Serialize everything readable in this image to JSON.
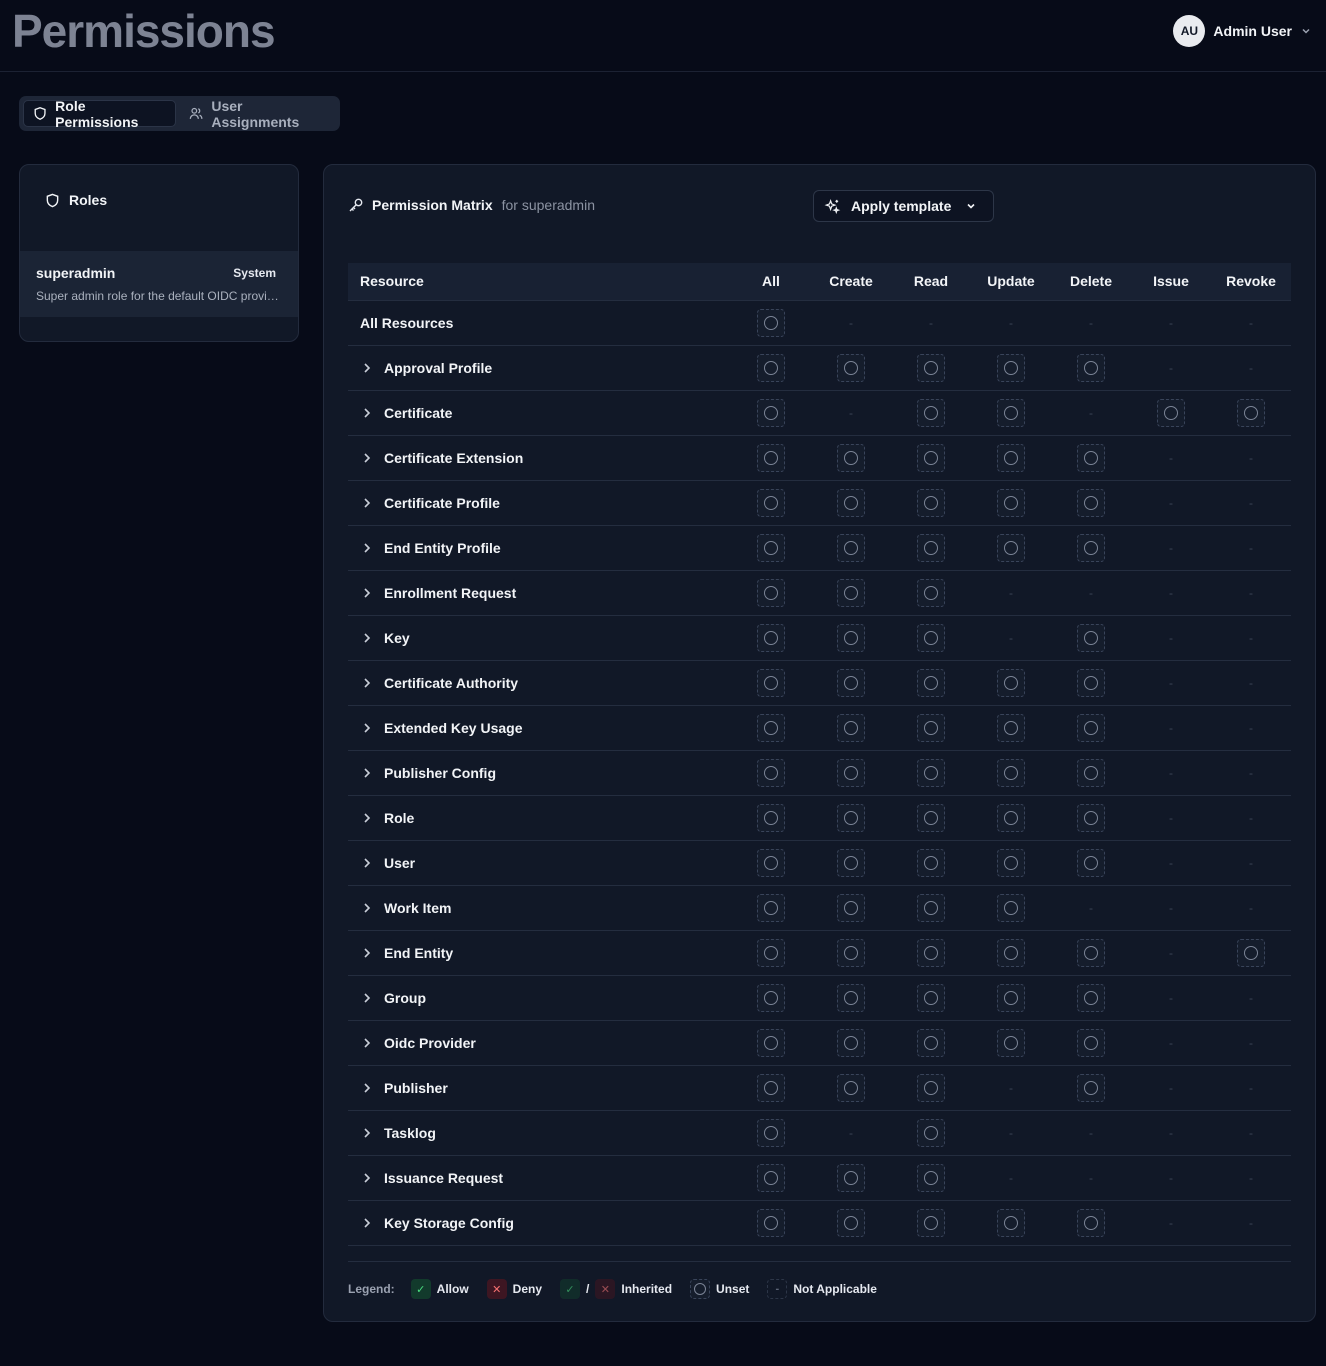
{
  "header": {
    "title": "Permissions",
    "user": {
      "initials": "AU",
      "name": "Admin User"
    }
  },
  "tabs": [
    {
      "label": "Role Permissions",
      "active": true
    },
    {
      "label": "User Assignments",
      "active": false
    }
  ],
  "roles": {
    "heading": "Roles",
    "items": [
      {
        "name": "superadmin",
        "badge": "System",
        "description": "Super admin role for the default OIDC provider"
      }
    ]
  },
  "matrix": {
    "title": "Permission Matrix",
    "subtitle": "for superadmin",
    "apply_template_label": "Apply template",
    "columns": [
      "Resource",
      "All",
      "Create",
      "Read",
      "Update",
      "Delete",
      "Issue",
      "Revoke"
    ],
    "na_symbol": "-",
    "rows": [
      {
        "name": "All Resources",
        "expandable": false,
        "cells": [
          "unset",
          "na",
          "na",
          "na",
          "na",
          "na",
          "na"
        ]
      },
      {
        "name": "Approval Profile",
        "expandable": true,
        "cells": [
          "unset",
          "unset",
          "unset",
          "unset",
          "unset",
          "na",
          "na"
        ]
      },
      {
        "name": "Certificate",
        "expandable": true,
        "cells": [
          "unset",
          "na",
          "unset",
          "unset",
          "na",
          "unset",
          "unset"
        ]
      },
      {
        "name": "Certificate Extension",
        "expandable": true,
        "cells": [
          "unset",
          "unset",
          "unset",
          "unset",
          "unset",
          "na",
          "na"
        ]
      },
      {
        "name": "Certificate Profile",
        "expandable": true,
        "cells": [
          "unset",
          "unset",
          "unset",
          "unset",
          "unset",
          "na",
          "na"
        ]
      },
      {
        "name": "End Entity Profile",
        "expandable": true,
        "cells": [
          "unset",
          "unset",
          "unset",
          "unset",
          "unset",
          "na",
          "na"
        ]
      },
      {
        "name": "Enrollment Request",
        "expandable": true,
        "cells": [
          "unset",
          "unset",
          "unset",
          "na",
          "na",
          "na",
          "na"
        ]
      },
      {
        "name": "Key",
        "expandable": true,
        "cells": [
          "unset",
          "unset",
          "unset",
          "na",
          "unset",
          "na",
          "na"
        ]
      },
      {
        "name": "Certificate Authority",
        "expandable": true,
        "cells": [
          "unset",
          "unset",
          "unset",
          "unset",
          "unset",
          "na",
          "na"
        ]
      },
      {
        "name": "Extended Key Usage",
        "expandable": true,
        "cells": [
          "unset",
          "unset",
          "unset",
          "unset",
          "unset",
          "na",
          "na"
        ]
      },
      {
        "name": "Publisher Config",
        "expandable": true,
        "cells": [
          "unset",
          "unset",
          "unset",
          "unset",
          "unset",
          "na",
          "na"
        ]
      },
      {
        "name": "Role",
        "expandable": true,
        "cells": [
          "unset",
          "unset",
          "unset",
          "unset",
          "unset",
          "na",
          "na"
        ]
      },
      {
        "name": "User",
        "expandable": true,
        "cells": [
          "unset",
          "unset",
          "unset",
          "unset",
          "unset",
          "na",
          "na"
        ]
      },
      {
        "name": "Work Item",
        "expandable": true,
        "cells": [
          "unset",
          "unset",
          "unset",
          "unset",
          "na",
          "na",
          "na"
        ]
      },
      {
        "name": "End Entity",
        "expandable": true,
        "cells": [
          "unset",
          "unset",
          "unset",
          "unset",
          "unset",
          "na",
          "unset"
        ]
      },
      {
        "name": "Group",
        "expandable": true,
        "cells": [
          "unset",
          "unset",
          "unset",
          "unset",
          "unset",
          "na",
          "na"
        ]
      },
      {
        "name": "Oidc Provider",
        "expandable": true,
        "cells": [
          "unset",
          "unset",
          "unset",
          "unset",
          "unset",
          "na",
          "na"
        ]
      },
      {
        "name": "Publisher",
        "expandable": true,
        "cells": [
          "unset",
          "unset",
          "unset",
          "na",
          "unset",
          "na",
          "na"
        ]
      },
      {
        "name": "Tasklog",
        "expandable": true,
        "cells": [
          "unset",
          "na",
          "unset",
          "na",
          "na",
          "na",
          "na"
        ]
      },
      {
        "name": "Issuance Request",
        "expandable": true,
        "cells": [
          "unset",
          "unset",
          "unset",
          "na",
          "na",
          "na",
          "na"
        ]
      },
      {
        "name": "Key Storage Config",
        "expandable": true,
        "cells": [
          "unset",
          "unset",
          "unset",
          "unset",
          "unset",
          "na",
          "na"
        ]
      }
    ]
  },
  "legend": {
    "label": "Legend:",
    "allow": "Allow",
    "deny": "Deny",
    "separator": "/",
    "inherited": "Inherited",
    "unset": "Unset",
    "not_applicable": "Not Applicable",
    "na_symbol": "-"
  },
  "colors": {
    "background": "#070b18",
    "card": "#111827",
    "allow": "#4ade80",
    "deny": "#f87171"
  }
}
